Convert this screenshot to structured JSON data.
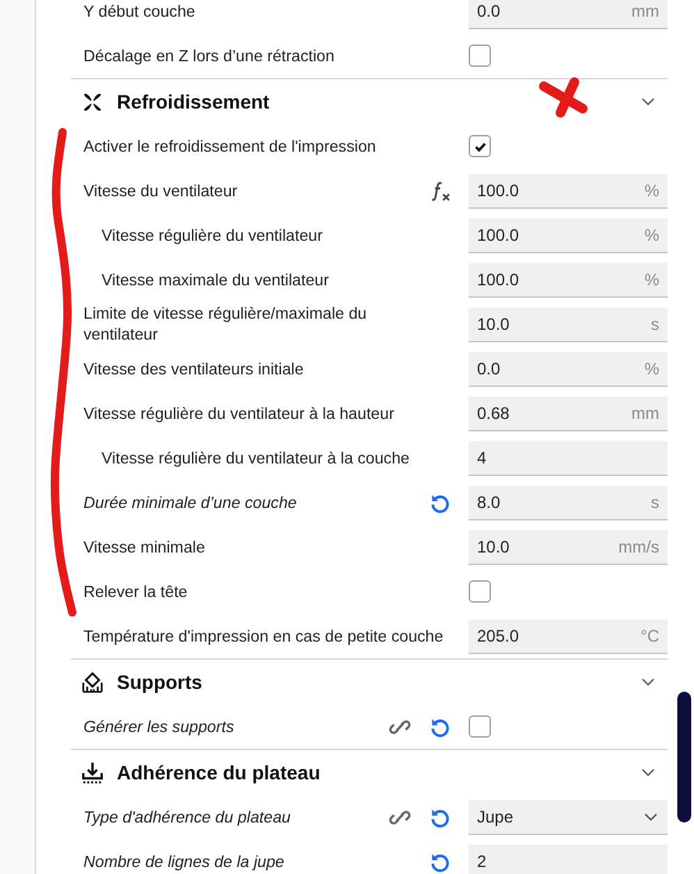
{
  "top_rows": [
    {
      "label": "Y début couche",
      "kind": "number",
      "value": "0.0",
      "unit": "mm",
      "italic": false,
      "formula": false,
      "linked": false,
      "reset": false
    },
    {
      "label": "Décalage en Z lors d’une rétraction",
      "kind": "checkbox",
      "checked": false,
      "italic": false,
      "formula": false,
      "linked": false,
      "reset": false
    }
  ],
  "sections": [
    {
      "title": "Refroidissement",
      "rows": [
        {
          "label": "Activer le refroidissement de l'impression",
          "kind": "checkbox",
          "checked": true,
          "italic": false,
          "formula": false,
          "linked": false,
          "reset": false
        },
        {
          "label": "Vitesse du ventilateur",
          "kind": "number",
          "value": "100.0",
          "unit": "%",
          "italic": false,
          "formula": true,
          "linked": false,
          "reset": false,
          "children": [
            {
              "label": "Vitesse régulière du ventilateur",
              "kind": "number",
              "value": "100.0",
              "unit": "%",
              "italic": false,
              "formula": false,
              "linked": false,
              "reset": false
            },
            {
              "label": "Vitesse maximale du ventilateur",
              "kind": "number",
              "value": "100.0",
              "unit": "%",
              "italic": false,
              "formula": false,
              "linked": false,
              "reset": false
            }
          ]
        },
        {
          "label": "Limite de vitesse régulière/maximale du ventilateur",
          "kind": "number",
          "value": "10.0",
          "unit": "s",
          "italic": false,
          "formula": false,
          "linked": false,
          "reset": false
        },
        {
          "label": "Vitesse des ventilateurs initiale",
          "kind": "number",
          "value": "0.0",
          "unit": "%",
          "italic": false,
          "formula": false,
          "linked": false,
          "reset": false
        },
        {
          "label": "Vitesse régulière du ventilateur à la hauteur",
          "kind": "number",
          "value": "0.68",
          "unit": "mm",
          "italic": false,
          "formula": false,
          "linked": false,
          "reset": false,
          "children": [
            {
              "label": "Vitesse régulière du ventilateur à la couche",
              "kind": "number",
              "value": "4",
              "italic": false,
              "formula": false,
              "linked": false,
              "reset": false
            }
          ]
        },
        {
          "label": "Durée minimale d’une couche",
          "kind": "number",
          "value": "8.0",
          "unit": "s",
          "italic": true,
          "formula": false,
          "linked": false,
          "reset": true
        },
        {
          "label": "Vitesse minimale",
          "kind": "number",
          "value": "10.0",
          "unit": "mm/s",
          "italic": false,
          "formula": false,
          "linked": false,
          "reset": false
        },
        {
          "label": "Relever la tête",
          "kind": "checkbox",
          "checked": false,
          "italic": false,
          "formula": false,
          "linked": false,
          "reset": false
        },
        {
          "label": "Température d'impression en cas de petite couche",
          "kind": "number",
          "value": "205.0",
          "unit": "°C",
          "italic": false,
          "formula": false,
          "linked": false,
          "reset": false
        }
      ]
    },
    {
      "title": "Supports",
      "rows": [
        {
          "label": "Générer les supports",
          "kind": "checkbox",
          "checked": false,
          "italic": true,
          "formula": false,
          "linked": true,
          "reset": true
        }
      ]
    },
    {
      "title": "Adhérence du plateau",
      "rows": [
        {
          "label": "Type d'adhérence du plateau",
          "kind": "select",
          "value": "Jupe",
          "italic": true,
          "formula": false,
          "linked": true,
          "reset": true
        },
        {
          "label": "Nombre de lignes de la jupe",
          "kind": "number",
          "value": "2",
          "italic": true,
          "formula": false,
          "linked": false,
          "reset": true
        }
      ]
    }
  ]
}
